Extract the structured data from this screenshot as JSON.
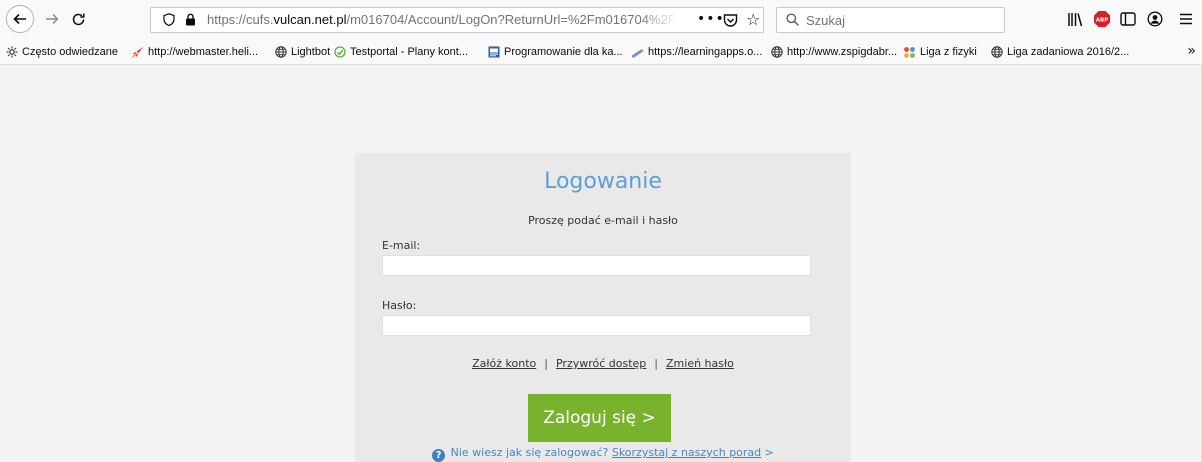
{
  "toolbar": {
    "url_prefix": "https://cufs.",
    "url_domain": "vulcan.net.pl",
    "url_path": "/m016704/Account/LogOn?ReturnUrl=%2Fm016704%2Fo...",
    "search_placeholder": "Szukaj",
    "more_label": "•••"
  },
  "bookmarks": [
    {
      "label": "Często odwiedzane",
      "icon": "gear-icon"
    },
    {
      "label": "http://webmaster.heli...",
      "icon": "rocket-icon"
    },
    {
      "label": "Lightbot",
      "icon": "globe-icon"
    },
    {
      "label": "Testportal - Plany kont...",
      "icon": "check-icon"
    },
    {
      "label": "Programowanie dla ka...",
      "icon": "code-icon"
    },
    {
      "label": "https://learningapps.o...",
      "icon": "pencil-icon"
    },
    {
      "label": "http://www.zspigdabr...",
      "icon": "globe-icon"
    },
    {
      "label": "Liga z fizyki",
      "icon": "joomla-icon"
    },
    {
      "label": "Liga zadaniowa 2016/2...",
      "icon": "globe-icon"
    }
  ],
  "login": {
    "title": "Logowanie",
    "subtitle": "Proszę podać e-mail i hasło",
    "email_label": "E-mail:",
    "email_value": "",
    "password_label": "Hasło:",
    "password_value": "",
    "link_create": "Załóż konto",
    "link_restore": "Przywróć dostęp",
    "link_change": "Zmień hasło",
    "separator": "|",
    "button_label": "Zaloguj się >",
    "help_text": "Nie wiesz jak się zalogować?",
    "help_link": "Skorzystaj z naszych porad",
    "help_arrow": ">"
  },
  "colors": {
    "title": "#5d9fd3",
    "button": "#79b32d",
    "panel": "#e9e9e9",
    "help_link": "#4b86b9"
  }
}
